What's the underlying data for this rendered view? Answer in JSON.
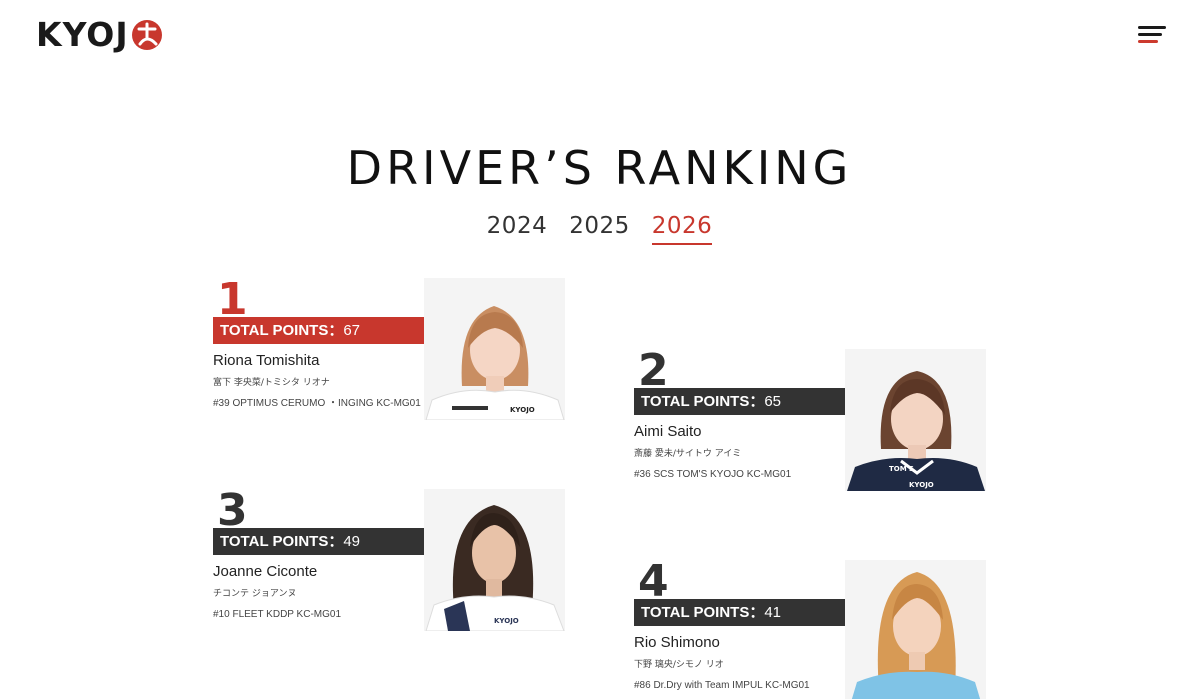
{
  "header": {
    "logo_text": "KYOJ",
    "logo_alt": "KYOJO",
    "menu_icon": "hamburger-menu-icon"
  },
  "page": {
    "title": "DRIVER’S RANKING",
    "years": [
      "2024",
      "2025",
      "2026"
    ],
    "active_year": "2026"
  },
  "colors": {
    "accent": "#c8372d",
    "dark_band": "#333333",
    "text": "#222222"
  },
  "drivers": [
    {
      "rank": "1",
      "points_label": "TOTAL POINTS：",
      "points": "67",
      "name": "Riona Tomishita",
      "kana": "富下 李央菜/トミシタ リオナ",
      "team": "#39 OPTIMUS CERUMO ・INGING KC-MG01",
      "photo": "driver-photo"
    },
    {
      "rank": "2",
      "points_label": "TOTAL POINTS：",
      "points": "65",
      "name": "Aimi Saito",
      "kana": "斎藤 愛未/サイトウ アイミ",
      "team": "#36 SCS TOM'S KYOJO KC-MG01",
      "photo": "driver-photo"
    },
    {
      "rank": "3",
      "points_label": "TOTAL POINTS：",
      "points": "49",
      "name": "Joanne Ciconte",
      "kana": "チコンテ ジョアンヌ",
      "team": "#10 FLEET KDDP KC-MG01",
      "photo": "driver-photo"
    },
    {
      "rank": "4",
      "points_label": "TOTAL POINTS：",
      "points": "41",
      "name": "Rio Shimono",
      "kana": "下野 璃央/シモノ リオ",
      "team": "#86 Dr.Dry with Team IMPUL KC-MG01",
      "photo": "driver-photo"
    }
  ]
}
